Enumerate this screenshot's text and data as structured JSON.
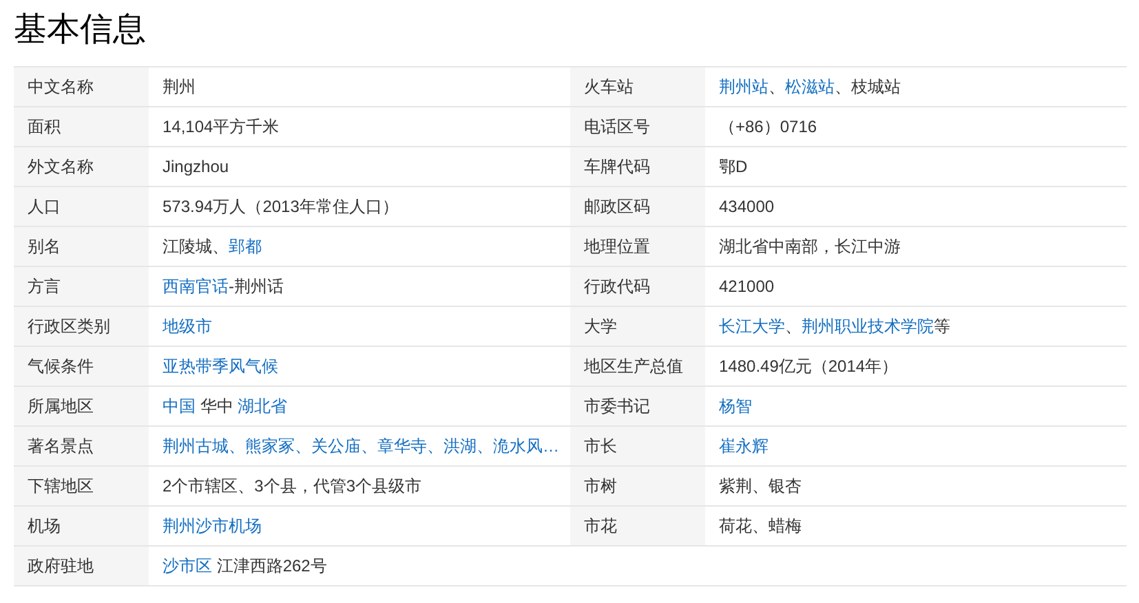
{
  "title": "基本信息",
  "columns": [
    {
      "rows": [
        {
          "label": "中文名称",
          "value": [
            {
              "text": "荆州",
              "link": false
            }
          ]
        },
        {
          "label": "面积",
          "value": [
            {
              "text": "14,104平方千米",
              "link": false
            }
          ]
        },
        {
          "label": "外文名称",
          "value": [
            {
              "text": "Jingzhou",
              "link": false
            }
          ]
        },
        {
          "label": "人口",
          "value": [
            {
              "text": "573.94万人（2013年常住人口）",
              "link": false
            }
          ]
        },
        {
          "label": "别名",
          "value": [
            {
              "text": "江陵城、",
              "link": false
            },
            {
              "text": "郢都",
              "link": true
            }
          ]
        },
        {
          "label": "方言",
          "value": [
            {
              "text": "西南官话",
              "link": true
            },
            {
              "text": "-荆州话",
              "link": false
            }
          ]
        },
        {
          "label": "行政区类别",
          "value": [
            {
              "text": "地级市",
              "link": true
            }
          ]
        },
        {
          "label": "气候条件",
          "value": [
            {
              "text": "亚热带季风气候",
              "link": true
            }
          ]
        },
        {
          "label": "所属地区",
          "value": [
            {
              "text": "中国",
              "link": true
            },
            {
              "text": " 华中 ",
              "link": false
            },
            {
              "text": "湖北省",
              "link": true
            }
          ]
        },
        {
          "label": "著名景点",
          "value": [
            {
              "text": "荆州古城、熊家冢、关公庙、章华寺、洪湖、洈水风…",
              "link": true
            }
          ]
        },
        {
          "label": "下辖地区",
          "value": [
            {
              "text": "2个市辖区、3个县，代管3个县级市",
              "link": false
            }
          ]
        },
        {
          "label": "机场",
          "value": [
            {
              "text": "荆州沙市机场",
              "link": true
            }
          ]
        },
        {
          "label": "政府驻地",
          "value": [
            {
              "text": "沙市区",
              "link": true
            },
            {
              "text": " 江津西路262号",
              "link": false
            }
          ]
        }
      ]
    },
    {
      "rows": [
        {
          "label": "火车站",
          "value": [
            {
              "text": "荆州站",
              "link": true
            },
            {
              "text": "、",
              "link": false
            },
            {
              "text": "松滋站",
              "link": true
            },
            {
              "text": "、枝城站",
              "link": false
            }
          ]
        },
        {
          "label": "电话区号",
          "value": [
            {
              "text": "（+86）0716",
              "link": false
            }
          ]
        },
        {
          "label": "车牌代码",
          "value": [
            {
              "text": "鄂D",
              "link": false
            }
          ]
        },
        {
          "label": "邮政区码",
          "value": [
            {
              "text": "434000",
              "link": false
            }
          ]
        },
        {
          "label": "地理位置",
          "value": [
            {
              "text": "湖北省中南部，长江中游",
              "link": false
            }
          ]
        },
        {
          "label": "行政代码",
          "value": [
            {
              "text": "421000",
              "link": false
            }
          ]
        },
        {
          "label": "大学",
          "value": [
            {
              "text": "长江大学",
              "link": true
            },
            {
              "text": "、",
              "link": false
            },
            {
              "text": "荆州职业技术学院",
              "link": true
            },
            {
              "text": "等",
              "link": false
            }
          ]
        },
        {
          "label": "地区生产总值",
          "value": [
            {
              "text": "1480.49亿元（2014年）",
              "link": false
            }
          ]
        },
        {
          "label": "市委书记",
          "value": [
            {
              "text": "杨智",
              "link": true
            }
          ]
        },
        {
          "label": "市长",
          "value": [
            {
              "text": "崔永辉",
              "link": true
            }
          ]
        },
        {
          "label": "市树",
          "value": [
            {
              "text": "紫荆、银杏",
              "link": false
            }
          ]
        },
        {
          "label": "市花",
          "value": [
            {
              "text": "荷花、蜡梅",
              "link": false
            }
          ]
        }
      ]
    }
  ]
}
